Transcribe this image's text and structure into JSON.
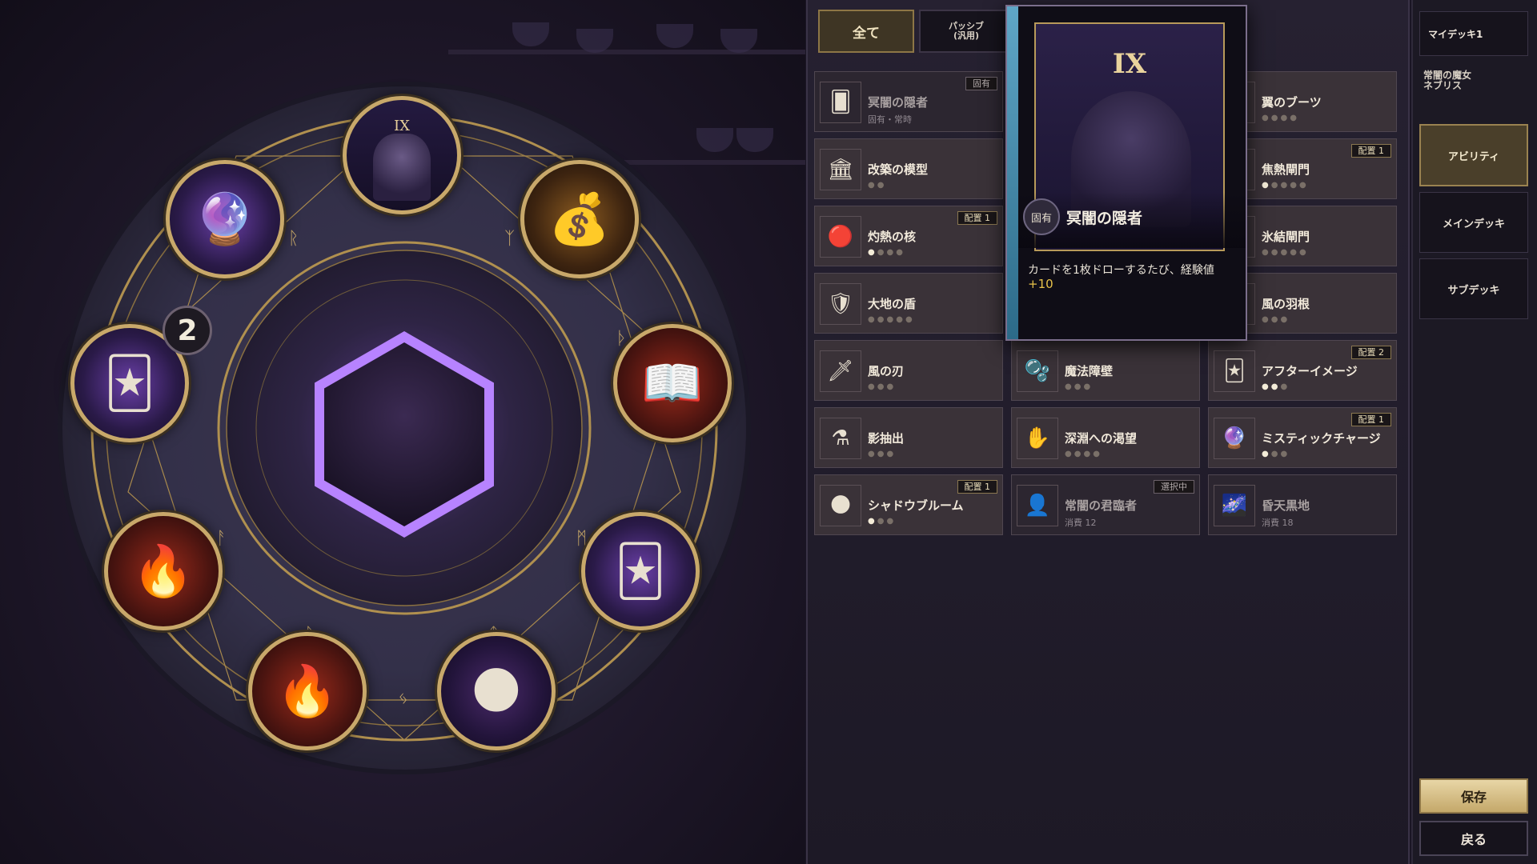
{
  "tabs": {
    "all": "全て",
    "passive": "パッシブ\n(汎用)"
  },
  "wheel": {
    "badge_count": "2",
    "top_card_numeral": "IX",
    "nodes": [
      {
        "key": "top",
        "icon": "tarot-card-icon",
        "glyph": ""
      },
      {
        "key": "upper-left",
        "icon": "purple-orb-icon",
        "glyph": "🔮"
      },
      {
        "key": "upper-right",
        "icon": "coin-bag-icon",
        "glyph": "💰"
      },
      {
        "key": "left",
        "icon": "purple-cards-icon",
        "glyph": "🃏"
      },
      {
        "key": "right",
        "icon": "spellbook-icon",
        "glyph": "📖"
      },
      {
        "key": "lower-left",
        "icon": "fire-orb-icon",
        "glyph": "🔥"
      },
      {
        "key": "lower-right",
        "icon": "purple-cards-icon",
        "glyph": "🃏"
      },
      {
        "key": "bottom-left",
        "icon": "fire-portal-icon",
        "glyph": "🔥"
      },
      {
        "key": "bottom-right",
        "icon": "shadow-flower-icon",
        "glyph": "🌑"
      }
    ]
  },
  "items": [
    {
      "name": "冥闇の隠者",
      "sub": "固有・常時",
      "tag": "固有",
      "tag_style": "grey",
      "dim": true,
      "icon": "hermit-card-icon",
      "glyph": "🂠"
    },
    {
      "name": "改築の模型",
      "dots_on": 0,
      "dots_total": 2,
      "icon": "model-icon",
      "glyph": "🏛"
    },
    {
      "name": "灼熱の核",
      "dots_on": 1,
      "dots_total": 4,
      "tag": "配置 1",
      "icon": "fire-core-icon",
      "glyph": "🔴"
    },
    {
      "name": "大地の盾",
      "dots_on": 0,
      "dots_total": 5,
      "icon": "shield-icon",
      "glyph": "🛡"
    },
    {
      "name": "風の刃",
      "dots_on": 0,
      "dots_total": 3,
      "icon": "wind-blade-icon",
      "glyph": "🗡"
    },
    {
      "name": "影抽出",
      "dots_on": 0,
      "dots_total": 3,
      "icon": "shadow-extract-icon",
      "glyph": "⚗"
    },
    {
      "name": "シャドウブルーム",
      "dots_on": 1,
      "dots_total": 3,
      "tag": "配置 1",
      "icon": "shadow-bloom-icon",
      "glyph": "🌑"
    },
    {
      "name": "魔法障壁",
      "dots_on": 0,
      "dots_total": 3,
      "icon": "magic-barrier-icon",
      "glyph": "🫧"
    },
    {
      "name": "深淵への渇望",
      "dots_on": 0,
      "dots_total": 4,
      "icon": "abyss-icon",
      "glyph": "✋"
    },
    {
      "name": "常闇の君臨者",
      "sub": "消費 12",
      "tag": "選択中",
      "tag_style": "grey",
      "dim": true,
      "icon": "dark-ruler-icon",
      "glyph": "👤"
    },
    {
      "name": "翼のブーツ",
      "dots_on": 0,
      "dots_total": 4,
      "icon": "wing-boots-icon",
      "glyph": "👢"
    },
    {
      "name": "焦熱閘門",
      "dots_on": 1,
      "dots_total": 5,
      "tag": "配置 1",
      "icon": "fire-gate-icon",
      "glyph": "🚪"
    },
    {
      "name": "氷結閘門",
      "dots_on": 0,
      "dots_total": 5,
      "icon": "ice-gate-icon",
      "glyph": "❄"
    },
    {
      "name": "風の羽根",
      "dots_on": 0,
      "dots_total": 3,
      "icon": "wind-feather-icon",
      "glyph": "🪶"
    },
    {
      "name": "アフターイメージ",
      "dots_on": 2,
      "dots_total": 3,
      "tag": "配置 2",
      "icon": "afterimage-icon",
      "glyph": "🃏"
    },
    {
      "name": "ミスティックチャージ",
      "dots_on": 1,
      "dots_total": 3,
      "tag": "配置 1",
      "icon": "mystic-charge-icon",
      "glyph": "🔮"
    },
    {
      "name": "昏天黒地",
      "sub": "消費 18",
      "dim": true,
      "icon": "dark-earth-icon",
      "glyph": "🌌"
    }
  ],
  "tooltip": {
    "numeral": "IX",
    "rarity": "固有",
    "name": "冥闇の隠者",
    "description": "カードを1枚ドローするたび、経験値",
    "value": "+10"
  },
  "side": {
    "deck_name": "マイデッキ1",
    "character_name": "常闇の魔女\nネブリス",
    "ability": "アビリティ",
    "main_deck": "メインデッキ",
    "sub_deck": "サブデッキ",
    "save": "保存",
    "back": "戻る"
  },
  "colors": {
    "accent_gold": "#c8a86a",
    "hex_glow": "#b783ff",
    "tooltip_value": "#e8c24a"
  }
}
